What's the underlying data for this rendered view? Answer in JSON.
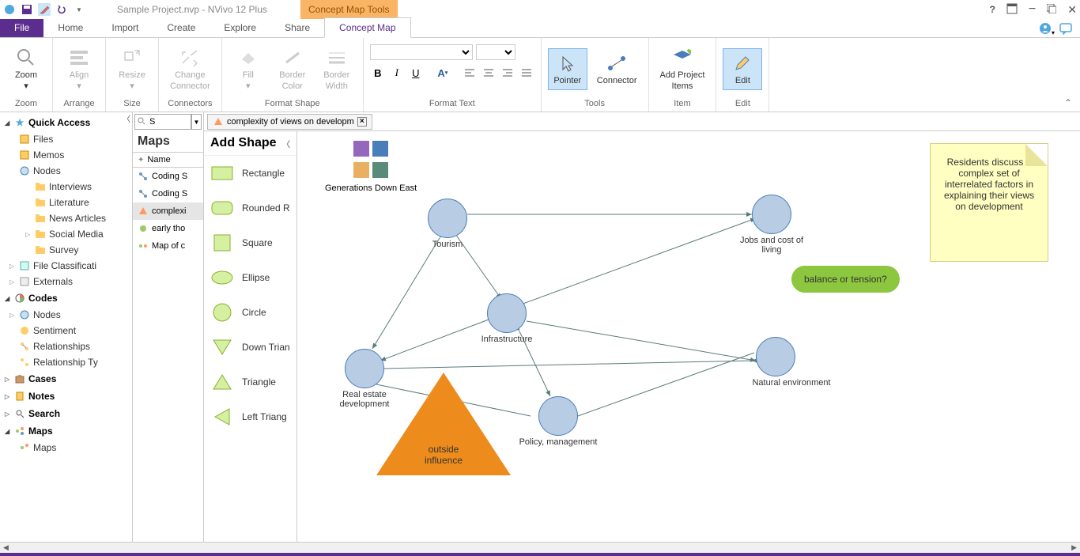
{
  "titlebar": {
    "title": "Sample Project.nvp - NVivo 12 Plus",
    "context_tab": "Concept Map Tools",
    "help": "?"
  },
  "ribbon_tabs": {
    "file": "File",
    "home": "Home",
    "import": "Import",
    "create": "Create",
    "explore": "Explore",
    "share": "Share",
    "concept_map": "Concept Map"
  },
  "ribbon": {
    "zoom": "Zoom",
    "zoom_grp": "Zoom",
    "align": "Align",
    "arrange_grp": "Arrange",
    "resize": "Resize",
    "size_grp": "Size",
    "change_connector": "Change\nConnector",
    "connectors_grp": "Connectors",
    "fill": "Fill",
    "border_color": "Border\nColor",
    "border_width": "Border\nWidth",
    "format_shape_grp": "Format Shape",
    "format_text_grp": "Format Text",
    "pointer": "Pointer",
    "connector": "Connector",
    "tools_grp": "Tools",
    "add_project": "Add Project\nItems",
    "item_grp": "Item",
    "edit": "Edit",
    "edit_grp": "Edit"
  },
  "nav": {
    "quick_access": "Quick Access",
    "files": "Files",
    "memos": "Memos",
    "nodes": "Nodes",
    "interviews": "Interviews",
    "literature": "Literature",
    "news_articles": "News Articles",
    "social_media": "Social Media",
    "survey": "Survey",
    "file_class": "File Classificati",
    "externals": "Externals",
    "codes": "Codes",
    "nodes2": "Nodes",
    "sentiment": "Sentiment",
    "relationships": "Relationships",
    "rel_types": "Relationship Ty",
    "cases": "Cases",
    "notes": "Notes",
    "search": "Search",
    "maps": "Maps",
    "maps_item": "Maps"
  },
  "maps_panel": {
    "search_val": "S",
    "title": "Maps",
    "col_name": "Name",
    "items": [
      "Coding S",
      "Coding S",
      "complexi",
      "early tho",
      "Map of c"
    ]
  },
  "doc_tab": {
    "label": "complexity of views on developm"
  },
  "shapes": {
    "header": "Add Shape",
    "rectangle": "Rectangle",
    "rounded": "Rounded R",
    "square": "Square",
    "ellipse": "Ellipse",
    "circle": "Circle",
    "down_tri": "Down Trian",
    "triangle": "Triangle",
    "left_tri": "Left Triang"
  },
  "diagram": {
    "legend": "Generations Down East",
    "tourism": "Tourism",
    "jobs": "Jobs and cost of living",
    "infrastructure": "Infrastructure",
    "realestate": "Real estate development",
    "policy": "Policy, management",
    "natural": "Natural environment",
    "outside": "outside influence",
    "balance": "balance or tension?",
    "note": "Residents discuss a complex set of interrelated factors in explaining their views on development"
  }
}
